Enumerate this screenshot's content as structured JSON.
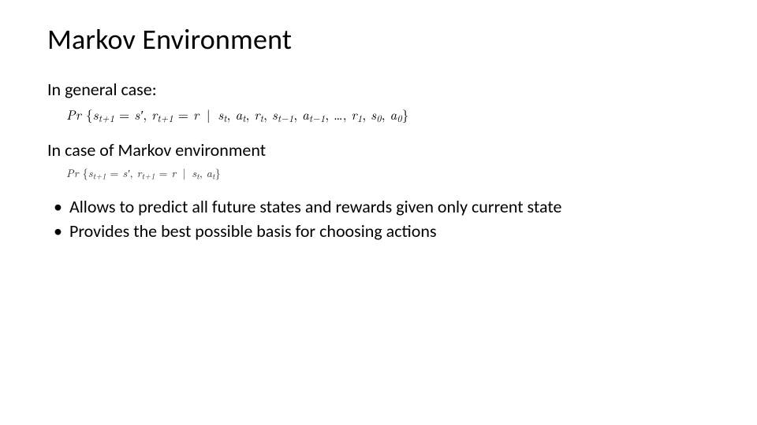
{
  "slide": {
    "title": "Markov Environment",
    "line1": "In general case:",
    "line2": "In case of Markov environment",
    "bullets": [
      "Allows to predict all future states and rewards given only current state",
      "Provides the best possible basis for choosing actions"
    ],
    "formula_general_text": "Pr { s_{t+1} = s', r_{t+1} = r | s_t, a_t, r_t, s_{t-1}, a_{t-1}, …, r_1, s_0, a_0 }",
    "formula_markov_text": "Pr { s_{t+1} = s', r_{t+1} = r | s_t, a_t }"
  }
}
